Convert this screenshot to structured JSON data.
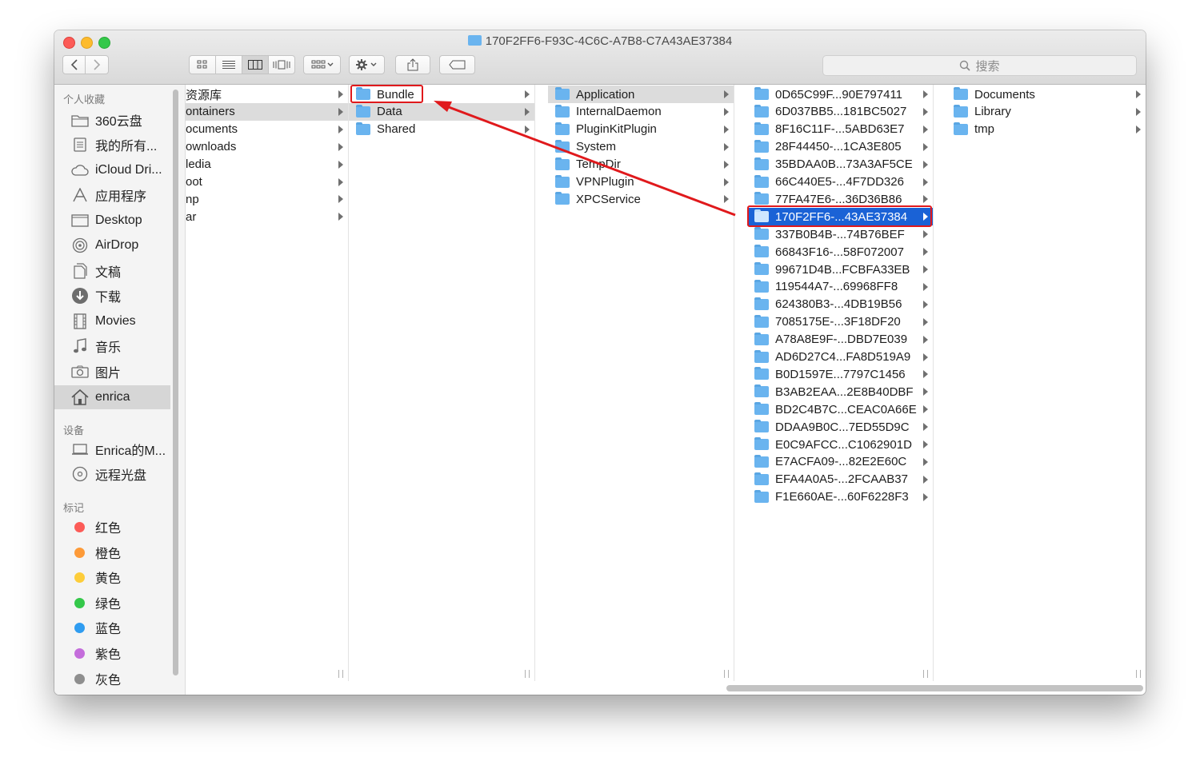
{
  "window": {
    "title": "170F2FF6-F93C-4C6C-A7B8-C7A43AE37384",
    "search_placeholder": "搜索"
  },
  "sidebar": {
    "sections": [
      {
        "title": "个人收藏",
        "items": [
          {
            "label": "360云盘",
            "icon": "folder-icon"
          },
          {
            "label": "我的所有...",
            "icon": "all-files-icon"
          },
          {
            "label": "iCloud Dri...",
            "icon": "cloud-icon"
          },
          {
            "label": "应用程序",
            "icon": "applications-icon"
          },
          {
            "label": "Desktop",
            "icon": "desktop-icon"
          },
          {
            "label": "AirDrop",
            "icon": "airdrop-icon"
          },
          {
            "label": "文稿",
            "icon": "documents-icon"
          },
          {
            "label": "下载",
            "icon": "download-icon"
          },
          {
            "label": "Movies",
            "icon": "film-icon"
          },
          {
            "label": "音乐",
            "icon": "music-icon"
          },
          {
            "label": "图片",
            "icon": "camera-icon"
          },
          {
            "label": "enrica",
            "icon": "home-icon",
            "selected": true
          }
        ]
      },
      {
        "title": "设备",
        "items": [
          {
            "label": "Enrica的M...",
            "icon": "laptop-icon"
          },
          {
            "label": "远程光盘",
            "icon": "disc-icon"
          }
        ]
      },
      {
        "title": "标记",
        "tags": [
          {
            "label": "红色",
            "color": "#fc5b57"
          },
          {
            "label": "橙色",
            "color": "#fd9a38"
          },
          {
            "label": "黄色",
            "color": "#fdcd3a"
          },
          {
            "label": "绿色",
            "color": "#34c84a"
          },
          {
            "label": "蓝色",
            "color": "#2f9cf0"
          },
          {
            "label": "紫色",
            "color": "#c46ddb"
          },
          {
            "label": "灰色",
            "color": "#8e8e8e"
          }
        ]
      }
    ]
  },
  "columns": [
    {
      "items": [
        "资源库",
        "ontainers",
        "ocuments",
        "ownloads",
        "ledia",
        "oot",
        "np",
        "ar"
      ],
      "highlight": 1
    },
    {
      "items": [
        "Bundle",
        "Data",
        "Shared"
      ],
      "highlight": 1
    },
    {
      "items": [
        "Application",
        "InternalDaemon",
        "PluginKitPlugin",
        "System",
        "TempDir",
        "VPNPlugin",
        "XPCService"
      ],
      "highlight": 0
    },
    {
      "items": [
        "0D65C99F...90E797411",
        "6D037BB5...181BC5027",
        "8F16C11F-...5ABD63E7",
        "28F44450-...1CA3E805",
        "35BDAA0B...73A3AF5CE",
        "66C440E5-...4F7DD326",
        "77FA47E6-...36D36B86",
        "170F2FF6-...43AE37384",
        "337B0B4B-...74B76BEF",
        "66843F16-...58F072007",
        "99671D4B...FCBFA33EB",
        "119544A7-...69968FF8",
        "624380B3-...4DB19B56",
        "7085175E-...3F18DF20",
        "A78A8E9F-...DBD7E039",
        "AD6D27C4...FA8D519A9",
        "B0D1597E...7797C1456",
        "B3AB2EAA...2E8B40DBF",
        "BD2C4B7C...CEAC0A66E",
        "DDAA9B0C...7ED55D9C",
        "E0C9AFCC...C1062901D",
        "E7ACFA09-...82E2E60C",
        "EFA4A0A5-...2FCAAB37",
        "F1E660AE-...60F6228F3"
      ],
      "selected": 7
    },
    {
      "items": [
        "Documents",
        "Library",
        "tmp"
      ]
    }
  ],
  "colors": {
    "selection": "#1a62d6",
    "annotation": "#e0191c",
    "folder": "#6ab4ef"
  }
}
